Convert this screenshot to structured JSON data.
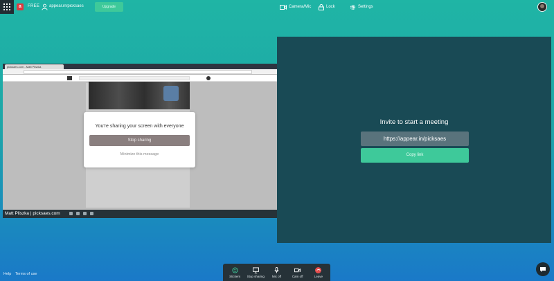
{
  "topbar": {
    "plan": "FREE",
    "room": "appear.in/picksaes",
    "upgrade_label": "Upgrade",
    "items": [
      {
        "label": "Camera/Mic",
        "icon": "camera-icon"
      },
      {
        "label": "Lock",
        "icon": "lock-icon"
      },
      {
        "label": "Settings",
        "icon": "gear-icon"
      }
    ]
  },
  "share": {
    "sharer_label": "Matt Pliszka | picksaes.com",
    "browser_tab": "picksaes.com - Matt Pliszka"
  },
  "modal": {
    "title": "You're sharing your screen with everyone",
    "stop_label": "Stop sharing",
    "minimize_label": "Minimize this message"
  },
  "invite": {
    "title": "Invite to start a meeting",
    "link": "https://appear.in/picksaes",
    "copy_label": "Copy link"
  },
  "footer": {
    "help": "Help",
    "terms": "Terms of use"
  },
  "controls": [
    {
      "label": "Stickers",
      "icon": "sticker-icon"
    },
    {
      "label": "Stop sharing",
      "icon": "screen-share-icon"
    },
    {
      "label": "Mic off",
      "icon": "mic-icon"
    },
    {
      "label": "Cam off",
      "icon": "camera-icon"
    },
    {
      "label": "Leave",
      "icon": "leave-icon"
    }
  ],
  "colors": {
    "accent_green": "#3ec99a",
    "panel_teal": "#194a55",
    "toolbar_dark": "#263238",
    "leave_red": "#e44e4e"
  }
}
